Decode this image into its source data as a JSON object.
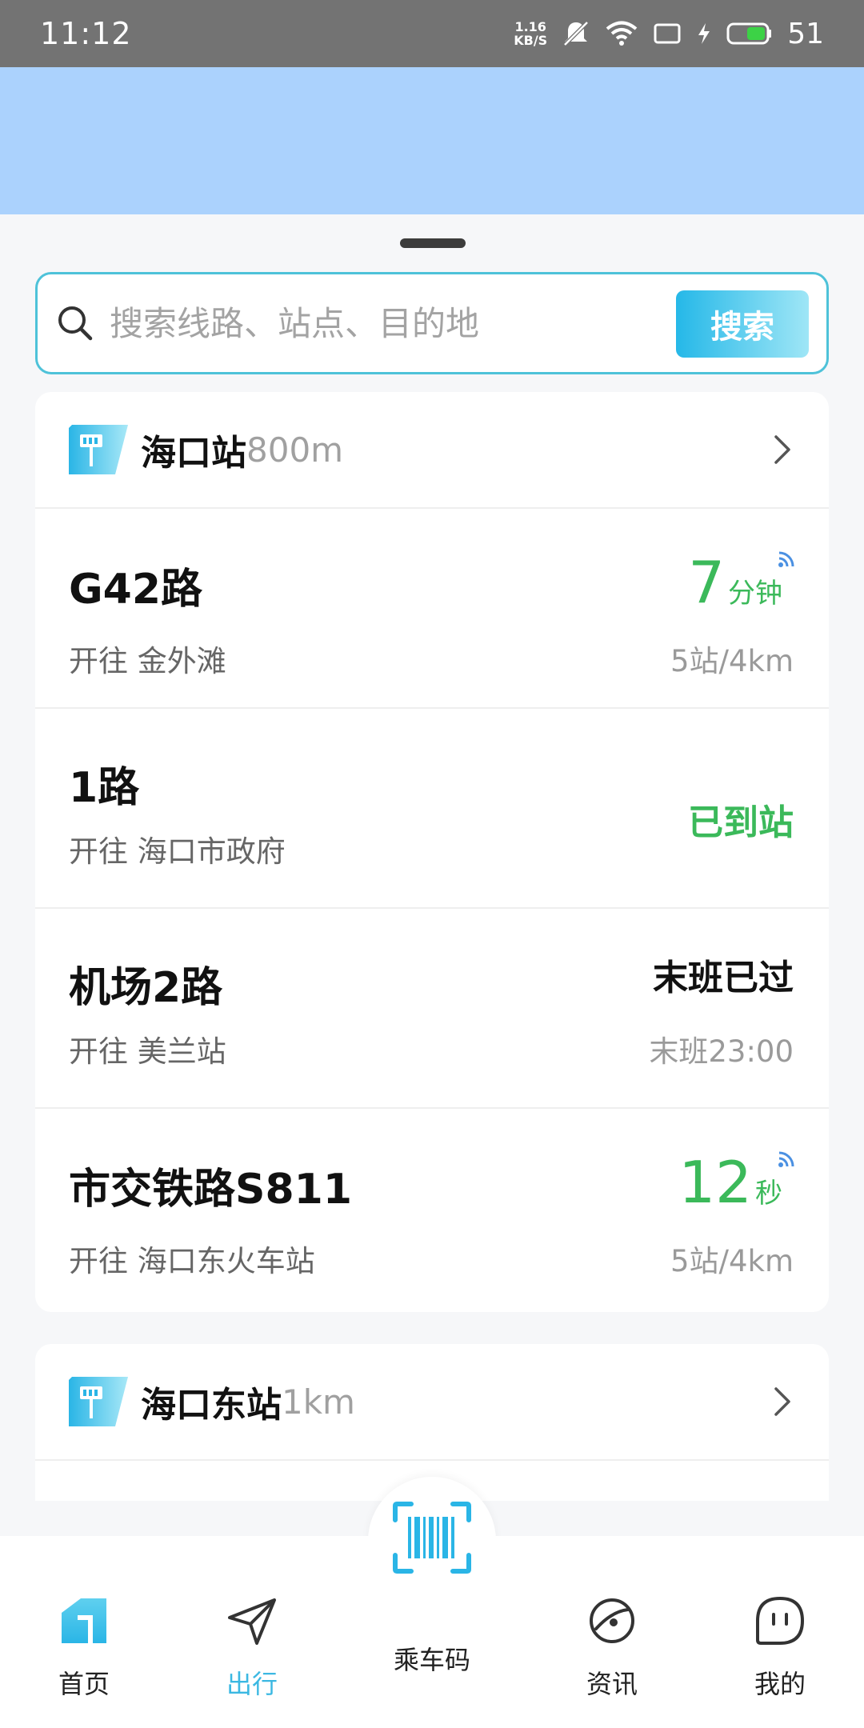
{
  "status_bar": {
    "time": "11:12",
    "net_speed_value": "1.16",
    "net_speed_unit": "KB/S",
    "battery": "51"
  },
  "search": {
    "placeholder": "搜索线路、站点、目的地",
    "button_label": "搜索"
  },
  "stations": [
    {
      "name": "海口站",
      "distance": "800m",
      "routes": [
        {
          "name": "G42路",
          "destination": "开往 金外滩",
          "eta_value": "7",
          "eta_unit": "分钟",
          "info": "5站/4km"
        },
        {
          "name": "1路",
          "destination": "开往 海口市政府",
          "status": "已到站"
        },
        {
          "name": "机场2路",
          "destination": "开往 美兰站",
          "status": "末班已过",
          "info": "末班23:00"
        },
        {
          "name": "市交铁路S811",
          "destination": "开往 海口东火车站",
          "eta_value": "12",
          "eta_unit": "秒",
          "info": "5站/4km"
        }
      ]
    },
    {
      "name": "海口东站",
      "distance": "1km"
    }
  ],
  "tabbar": {
    "home": "首页",
    "travel": "出行",
    "ride_code": "乘车码",
    "news": "资讯",
    "mine": "我的"
  },
  "colors": {
    "accent": "#3bb8e2",
    "eta_green": "#3bb95a",
    "map_blue": "#abd2fd"
  }
}
